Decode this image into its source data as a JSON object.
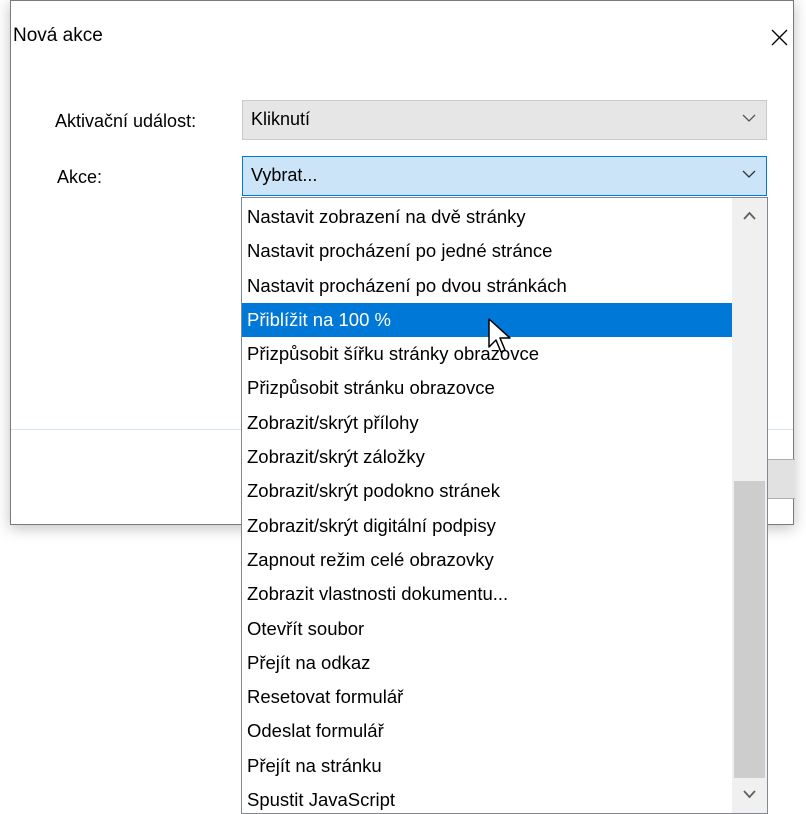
{
  "dialog": {
    "title": "Nová akce",
    "close_icon": "close-icon"
  },
  "form": {
    "event_label": "Aktivační událost:",
    "event_value": "Kliknutí",
    "action_label": "Akce:",
    "action_value": "Vybrat..."
  },
  "dropdown": {
    "items": [
      "Nastavit zobrazení na dvě stránky",
      "Nastavit procházení po jedné stránce",
      "Nastavit procházení po dvou stránkách",
      "Přiblížit na 100 %",
      "Přizpůsobit šířku stránky obrazovce",
      "Přizpůsobit stránku obrazovce",
      "Zobrazit/skrýt přílohy",
      "Zobrazit/skrýt záložky",
      "Zobrazit/skrýt podokno stránek",
      "Zobrazit/skrýt digitální podpisy",
      "Zapnout režim celé obrazovky",
      "Zobrazit vlastnosti dokumentu...",
      "Otevřít soubor",
      "Přejít na odkaz",
      "Resetovat formulář",
      "Odeslat formulář",
      "Přejít na stránku",
      "Spustit JavaScript"
    ],
    "selected_index": 3,
    "scroll_position": "bottom"
  },
  "colors": {
    "selection": "#0078d7",
    "combo_focus_bg": "#cce4f7",
    "combo_disabled_bg": "#e6e6e6",
    "scroll_thumb": "#cdcdcd"
  }
}
